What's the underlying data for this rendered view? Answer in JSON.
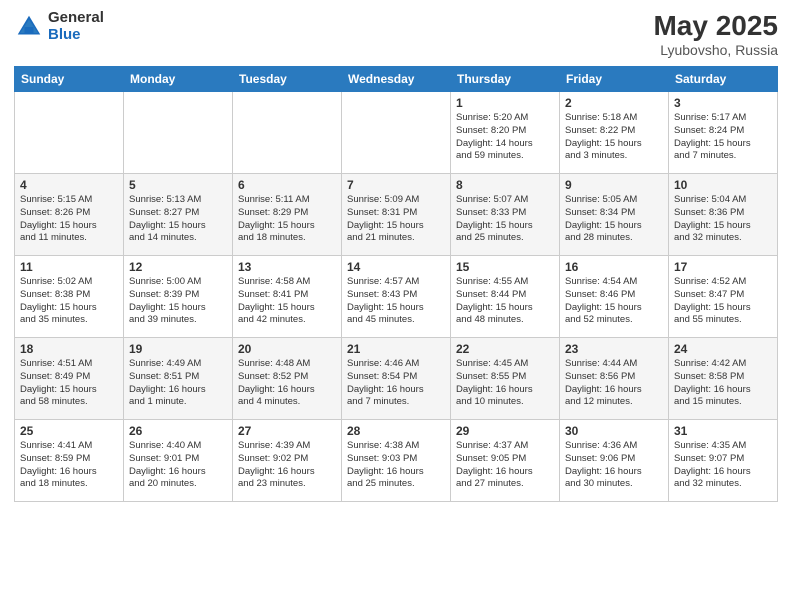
{
  "header": {
    "logo_general": "General",
    "logo_blue": "Blue",
    "title_month": "May 2025",
    "title_location": "Lyubovsho, Russia"
  },
  "weekdays": [
    "Sunday",
    "Monday",
    "Tuesday",
    "Wednesday",
    "Thursday",
    "Friday",
    "Saturday"
  ],
  "weeks": [
    [
      {
        "day": "",
        "info": ""
      },
      {
        "day": "",
        "info": ""
      },
      {
        "day": "",
        "info": ""
      },
      {
        "day": "",
        "info": ""
      },
      {
        "day": "1",
        "info": "Sunrise: 5:20 AM\nSunset: 8:20 PM\nDaylight: 14 hours\nand 59 minutes."
      },
      {
        "day": "2",
        "info": "Sunrise: 5:18 AM\nSunset: 8:22 PM\nDaylight: 15 hours\nand 3 minutes."
      },
      {
        "day": "3",
        "info": "Sunrise: 5:17 AM\nSunset: 8:24 PM\nDaylight: 15 hours\nand 7 minutes."
      }
    ],
    [
      {
        "day": "4",
        "info": "Sunrise: 5:15 AM\nSunset: 8:26 PM\nDaylight: 15 hours\nand 11 minutes."
      },
      {
        "day": "5",
        "info": "Sunrise: 5:13 AM\nSunset: 8:27 PM\nDaylight: 15 hours\nand 14 minutes."
      },
      {
        "day": "6",
        "info": "Sunrise: 5:11 AM\nSunset: 8:29 PM\nDaylight: 15 hours\nand 18 minutes."
      },
      {
        "day": "7",
        "info": "Sunrise: 5:09 AM\nSunset: 8:31 PM\nDaylight: 15 hours\nand 21 minutes."
      },
      {
        "day": "8",
        "info": "Sunrise: 5:07 AM\nSunset: 8:33 PM\nDaylight: 15 hours\nand 25 minutes."
      },
      {
        "day": "9",
        "info": "Sunrise: 5:05 AM\nSunset: 8:34 PM\nDaylight: 15 hours\nand 28 minutes."
      },
      {
        "day": "10",
        "info": "Sunrise: 5:04 AM\nSunset: 8:36 PM\nDaylight: 15 hours\nand 32 minutes."
      }
    ],
    [
      {
        "day": "11",
        "info": "Sunrise: 5:02 AM\nSunset: 8:38 PM\nDaylight: 15 hours\nand 35 minutes."
      },
      {
        "day": "12",
        "info": "Sunrise: 5:00 AM\nSunset: 8:39 PM\nDaylight: 15 hours\nand 39 minutes."
      },
      {
        "day": "13",
        "info": "Sunrise: 4:58 AM\nSunset: 8:41 PM\nDaylight: 15 hours\nand 42 minutes."
      },
      {
        "day": "14",
        "info": "Sunrise: 4:57 AM\nSunset: 8:43 PM\nDaylight: 15 hours\nand 45 minutes."
      },
      {
        "day": "15",
        "info": "Sunrise: 4:55 AM\nSunset: 8:44 PM\nDaylight: 15 hours\nand 48 minutes."
      },
      {
        "day": "16",
        "info": "Sunrise: 4:54 AM\nSunset: 8:46 PM\nDaylight: 15 hours\nand 52 minutes."
      },
      {
        "day": "17",
        "info": "Sunrise: 4:52 AM\nSunset: 8:47 PM\nDaylight: 15 hours\nand 55 minutes."
      }
    ],
    [
      {
        "day": "18",
        "info": "Sunrise: 4:51 AM\nSunset: 8:49 PM\nDaylight: 15 hours\nand 58 minutes."
      },
      {
        "day": "19",
        "info": "Sunrise: 4:49 AM\nSunset: 8:51 PM\nDaylight: 16 hours\nand 1 minute."
      },
      {
        "day": "20",
        "info": "Sunrise: 4:48 AM\nSunset: 8:52 PM\nDaylight: 16 hours\nand 4 minutes."
      },
      {
        "day": "21",
        "info": "Sunrise: 4:46 AM\nSunset: 8:54 PM\nDaylight: 16 hours\nand 7 minutes."
      },
      {
        "day": "22",
        "info": "Sunrise: 4:45 AM\nSunset: 8:55 PM\nDaylight: 16 hours\nand 10 minutes."
      },
      {
        "day": "23",
        "info": "Sunrise: 4:44 AM\nSunset: 8:56 PM\nDaylight: 16 hours\nand 12 minutes."
      },
      {
        "day": "24",
        "info": "Sunrise: 4:42 AM\nSunset: 8:58 PM\nDaylight: 16 hours\nand 15 minutes."
      }
    ],
    [
      {
        "day": "25",
        "info": "Sunrise: 4:41 AM\nSunset: 8:59 PM\nDaylight: 16 hours\nand 18 minutes."
      },
      {
        "day": "26",
        "info": "Sunrise: 4:40 AM\nSunset: 9:01 PM\nDaylight: 16 hours\nand 20 minutes."
      },
      {
        "day": "27",
        "info": "Sunrise: 4:39 AM\nSunset: 9:02 PM\nDaylight: 16 hours\nand 23 minutes."
      },
      {
        "day": "28",
        "info": "Sunrise: 4:38 AM\nSunset: 9:03 PM\nDaylight: 16 hours\nand 25 minutes."
      },
      {
        "day": "29",
        "info": "Sunrise: 4:37 AM\nSunset: 9:05 PM\nDaylight: 16 hours\nand 27 minutes."
      },
      {
        "day": "30",
        "info": "Sunrise: 4:36 AM\nSunset: 9:06 PM\nDaylight: 16 hours\nand 30 minutes."
      },
      {
        "day": "31",
        "info": "Sunrise: 4:35 AM\nSunset: 9:07 PM\nDaylight: 16 hours\nand 32 minutes."
      }
    ]
  ]
}
